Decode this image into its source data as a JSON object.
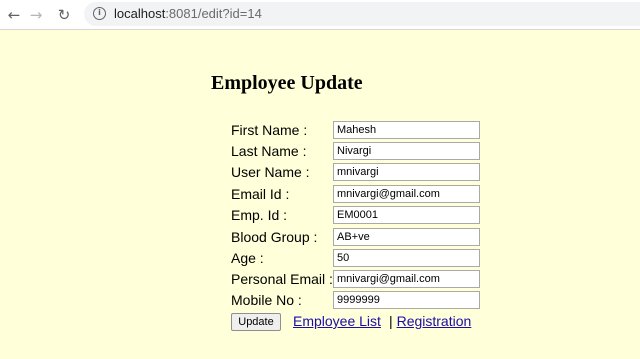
{
  "browser": {
    "url_host": "localhost",
    "url_rest": ":8081/edit?id=14",
    "icons": {
      "back": "arrow-left-icon",
      "forward": "arrow-right-icon",
      "reload": "reload-icon",
      "info": "info-icon"
    }
  },
  "page": {
    "title": "Employee Update"
  },
  "form": {
    "fields": [
      {
        "label": "First Name :",
        "value": "Mahesh"
      },
      {
        "label": "Last Name :",
        "value": "Nivargi"
      },
      {
        "label": "User Name :",
        "value": "mnivargi"
      },
      {
        "label": "Email Id :",
        "value": "mnivargi@gmail.com"
      },
      {
        "label": "Emp. Id :",
        "value": "EM0001"
      },
      {
        "label": "Blood Group :",
        "value": "AB+ve"
      },
      {
        "label": "Age :",
        "value": "50"
      },
      {
        "label": "Personal Email :",
        "value": "mnivargi@gmail.com"
      },
      {
        "label": "Mobile No :",
        "value": "9999999"
      }
    ],
    "update_label": "Update"
  },
  "links": {
    "employee_list": "Employee List",
    "separator": "|",
    "registration": "Registration"
  },
  "colors": {
    "page_background": "#ffffd9",
    "link": "#1a0dab"
  }
}
